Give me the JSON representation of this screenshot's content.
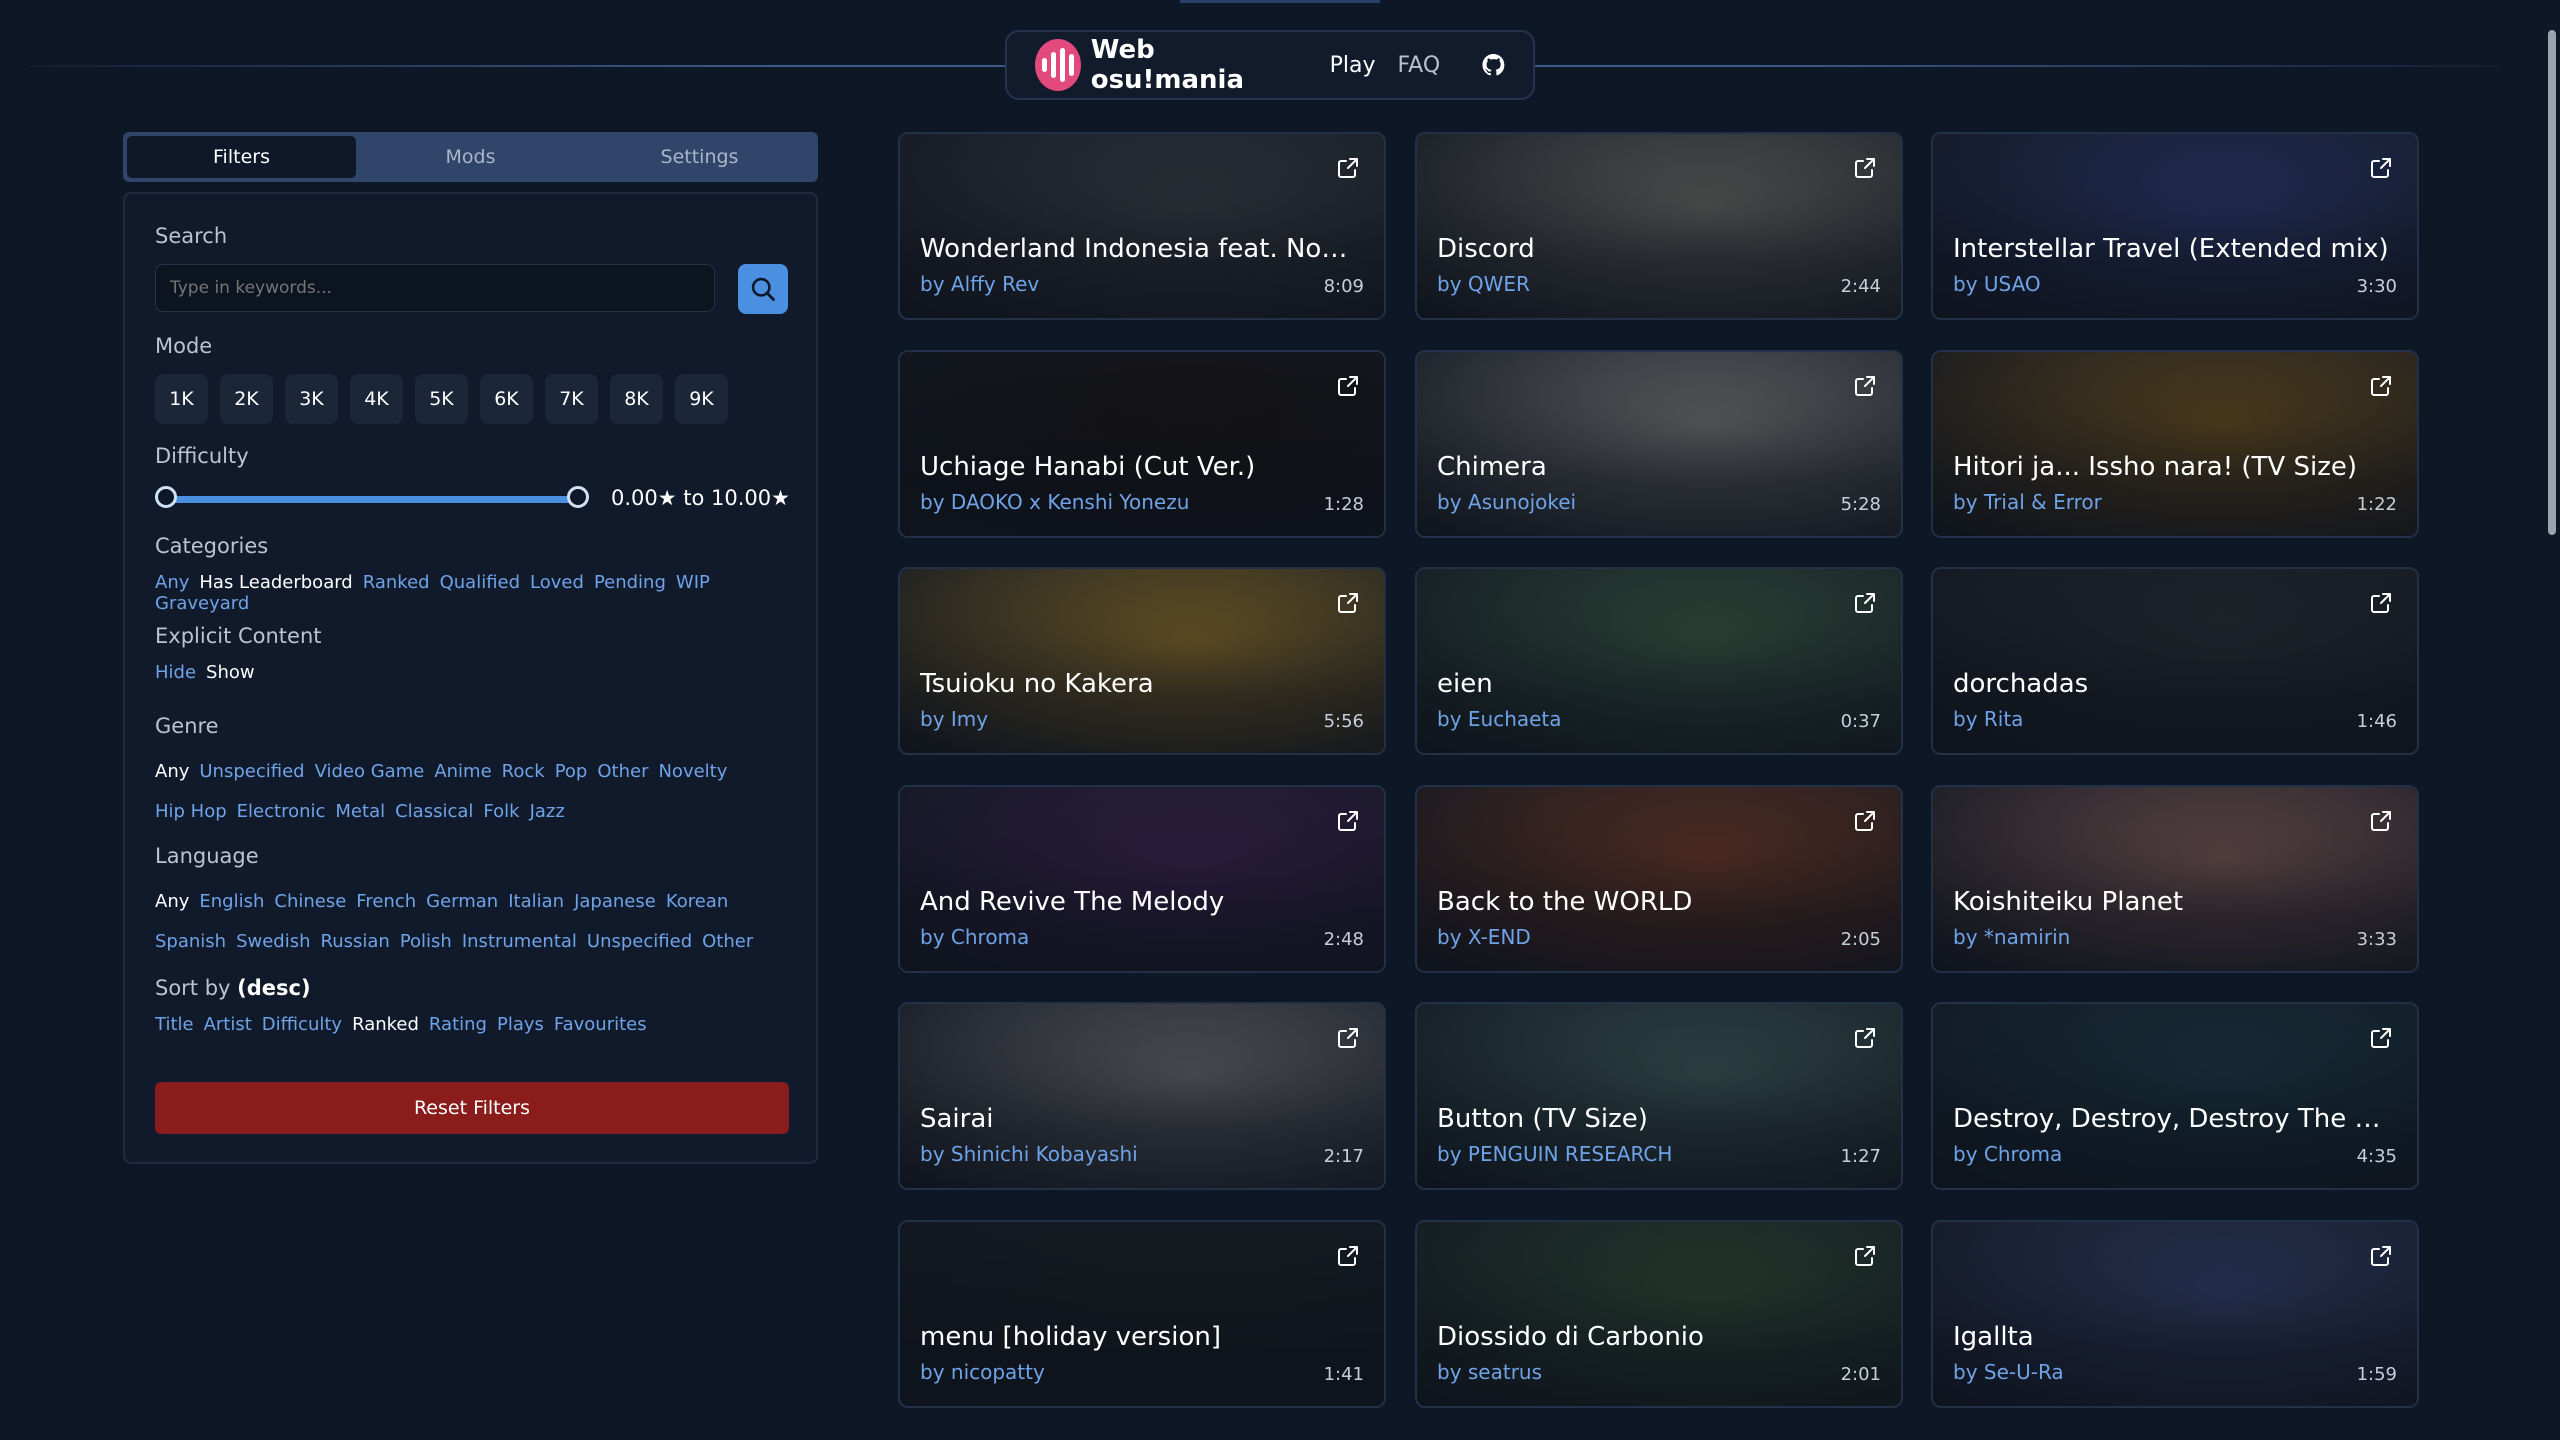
{
  "nav": {
    "brand": "Web osu!mania",
    "play": "Play",
    "faq": "FAQ"
  },
  "sidebar": {
    "tabs": [
      "Filters",
      "Mods",
      "Settings"
    ],
    "search_label": "Search",
    "search_placeholder": "Type in keywords...",
    "mode_label": "Mode",
    "modes": [
      "1K",
      "2K",
      "3K",
      "4K",
      "5K",
      "6K",
      "7K",
      "8K",
      "9K"
    ],
    "difficulty_label": "Difficulty",
    "difficulty_value": "0.00★ to 10.00★",
    "categories_label": "Categories",
    "categories": [
      "Any",
      "Has Leaderboard",
      "Ranked",
      "Qualified",
      "Loved",
      "Pending",
      "WIP",
      "Graveyard"
    ],
    "explicit_label": "Explicit Content",
    "explicit": [
      "Hide",
      "Show"
    ],
    "genre_label": "Genre",
    "genre": [
      "Any",
      "Unspecified",
      "Video Game",
      "Anime",
      "Rock",
      "Pop",
      "Other",
      "Novelty",
      "Hip Hop",
      "Electronic",
      "Metal",
      "Classical",
      "Folk",
      "Jazz"
    ],
    "language_label": "Language",
    "language": [
      "Any",
      "English",
      "Chinese",
      "French",
      "German",
      "Italian",
      "Japanese",
      "Korean",
      "Spanish",
      "Swedish",
      "Russian",
      "Polish",
      "Instrumental",
      "Unspecified",
      "Other"
    ],
    "sort_label": "Sort by",
    "sort_dir": "(desc)",
    "sort": [
      "Title",
      "Artist",
      "Difficulty",
      "Ranked",
      "Rating",
      "Plays",
      "Favourites"
    ],
    "reset": "Reset Filters"
  },
  "cards": [
    {
      "title": "Wonderland Indonesia feat. Novia…",
      "artist": "by Alffy Rev",
      "duration": "8:09"
    },
    {
      "title": "Discord",
      "artist": "by QWER",
      "duration": "2:44"
    },
    {
      "title": "Interstellar Travel (Extended mix)",
      "artist": "by USAO",
      "duration": "3:30"
    },
    {
      "title": "Uchiage Hanabi (Cut Ver.)",
      "artist": "by DAOKO x Kenshi Yonezu",
      "duration": "1:28"
    },
    {
      "title": "Chimera",
      "artist": "by Asunojokei",
      "duration": "5:28"
    },
    {
      "title": "Hitori ja... Issho nara! (TV Size)",
      "artist": "by Trial & Error",
      "duration": "1:22"
    },
    {
      "title": "Tsuioku no Kakera",
      "artist": "by Imy",
      "duration": "5:56"
    },
    {
      "title": "eien",
      "artist": "by Euchaeta",
      "duration": "0:37"
    },
    {
      "title": "dorchadas",
      "artist": "by Rita",
      "duration": "1:46"
    },
    {
      "title": "And Revive The Melody",
      "artist": "by Chroma",
      "duration": "2:48"
    },
    {
      "title": "Back to the WORLD",
      "artist": "by X-END",
      "duration": "2:05"
    },
    {
      "title": "Koishiteiku Planet",
      "artist": "by *namirin",
      "duration": "3:33"
    },
    {
      "title": "Sairai",
      "artist": "by Shinichi Kobayashi",
      "duration": "2:17"
    },
    {
      "title": "Button (TV Size)",
      "artist": "by PENGUIN RESEARCH",
      "duration": "1:27"
    },
    {
      "title": "Destroy, Destroy, Destroy The Happ…",
      "artist": "by Chroma",
      "duration": "4:35"
    },
    {
      "title": "menu [holiday version]",
      "artist": "by nicopatty",
      "duration": "1:41"
    },
    {
      "title": "Diossido di Carbonio",
      "artist": "by seatrus",
      "duration": "2:01"
    },
    {
      "title": "Igallta",
      "artist": "by Se-U-Ra",
      "duration": "1:59"
    }
  ],
  "card_colors": [
    "#3a4048",
    "#6b6a66",
    "#2c3a6e",
    "#1a1616",
    "#7a7a7a",
    "#6b5020",
    "#8a6e2c",
    "#3a5a46",
    "#2a2e36",
    "#3b2552",
    "#6e3a28",
    "#7a5a58",
    "#6a6a70",
    "#3d5a5a",
    "#1d3a48",
    "#1a2226",
    "#2f4a36",
    "#33406a"
  ],
  "colors": {
    "accent": "#4a8fe0",
    "reset": "#8a1c1c",
    "logo": "#e2497c"
  }
}
